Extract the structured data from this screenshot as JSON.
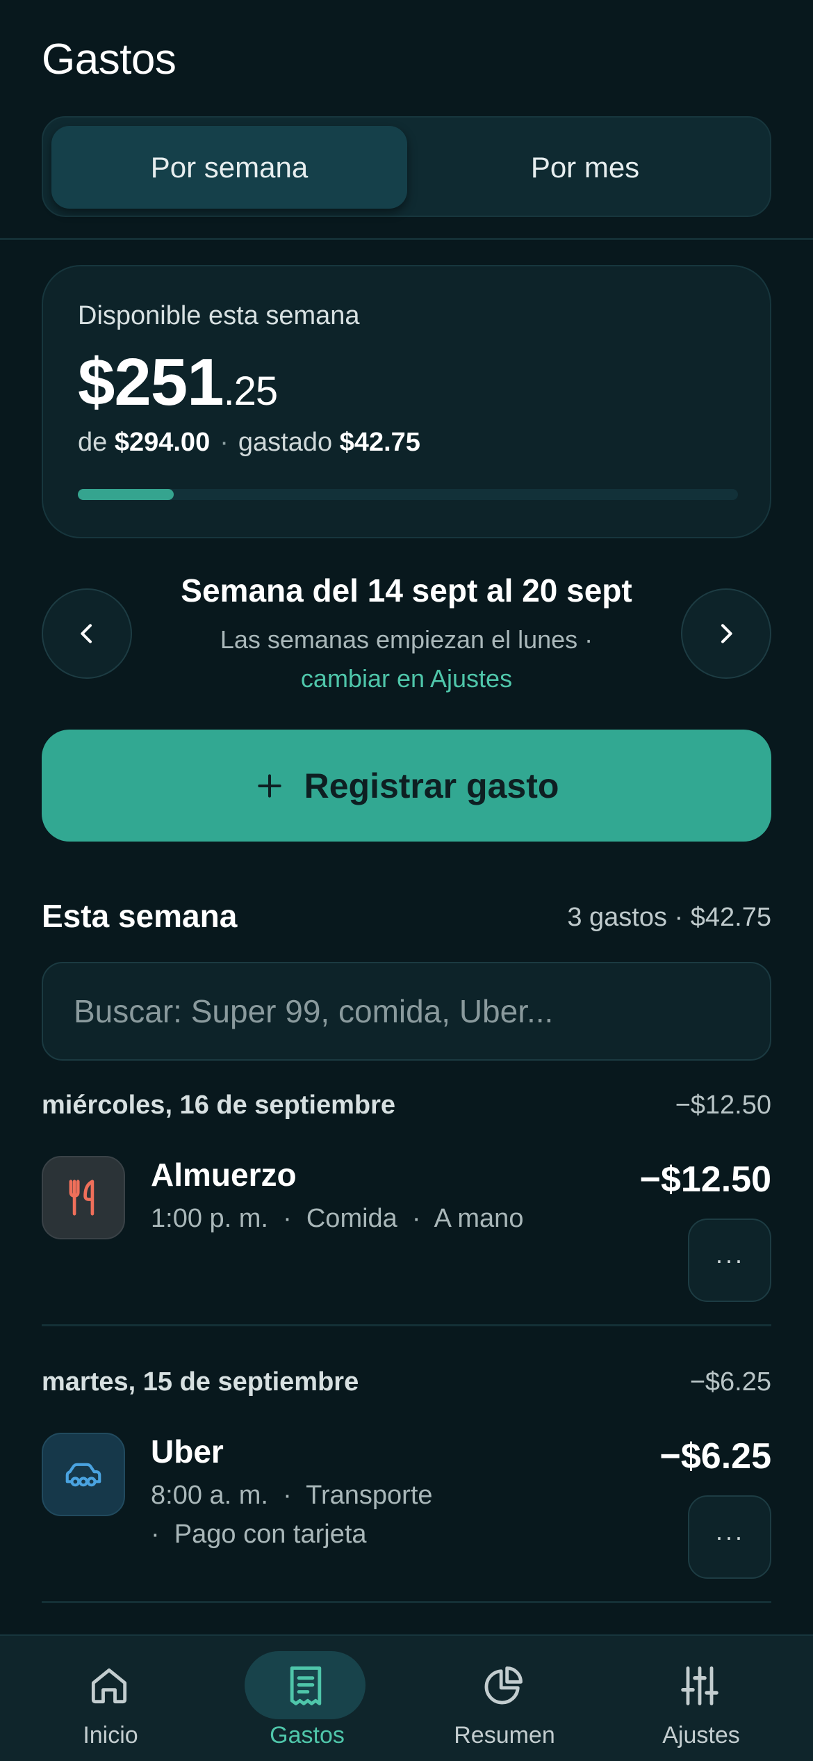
{
  "header": {
    "title": "Gastos"
  },
  "period_toggle": {
    "week_label": "Por semana",
    "month_label": "Por mes"
  },
  "budget": {
    "label": "Disponible esta semana",
    "amount_main": "$251",
    "amount_cents": ".25",
    "of_prefix": "de",
    "total": "$294.00",
    "separator": "·",
    "spent_prefix": "gastado",
    "spent": "$42.75",
    "progress_fraction": 0.145
  },
  "week_nav": {
    "title": "Semana del 14 sept al 20 sept",
    "hint": "Las semanas empiezan el lunes ·",
    "link": "cambiar en Ajustes"
  },
  "primary_action": {
    "label": "Registrar gasto",
    "icon": "plus-icon"
  },
  "list_section": {
    "title": "Esta semana",
    "summary": "3 gastos · $42.75"
  },
  "search": {
    "placeholder": "Buscar: Super 99, comida, Uber...",
    "value": ""
  },
  "days": [
    {
      "label": "miércoles, 16 de septiembre",
      "total": "−$12.50",
      "expenses": [
        {
          "name": "Almuerzo",
          "meta": "1:00 p. m.  ·  Comida  ·  A mano",
          "amount": "−$12.50",
          "icon": "utensils-icon",
          "more": "···"
        }
      ]
    },
    {
      "label": "martes, 15 de septiembre",
      "total": "−$6.25",
      "expenses": [
        {
          "name": "Uber",
          "meta_line1": "8:00 a. m.  ·  Transporte",
          "meta_line2": "·  Pago con tarjeta",
          "amount": "−$6.25",
          "icon": "car-icon",
          "more": "···"
        }
      ]
    }
  ],
  "tabbar": {
    "items": [
      {
        "label": "Inicio",
        "icon": "home-icon"
      },
      {
        "label": "Gastos",
        "icon": "receipt-icon",
        "active": true
      },
      {
        "label": "Resumen",
        "icon": "pie-chart-icon"
      },
      {
        "label": "Ajustes",
        "icon": "sliders-icon"
      }
    ]
  },
  "colors": {
    "accent": "#32a892",
    "accent_text": "#4fc6aa",
    "background": "#08181d",
    "card": "#0d2329"
  }
}
